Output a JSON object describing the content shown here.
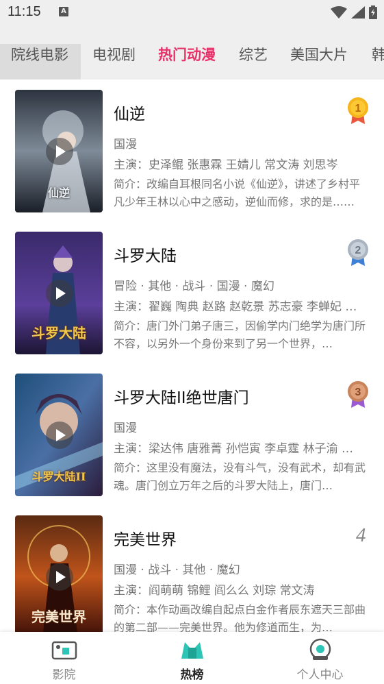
{
  "status_bar": {
    "time": "11:15",
    "notification_icon": "a-box-icon",
    "icons": [
      "wifi-icon",
      "signal-icon",
      "battery-charging-icon"
    ]
  },
  "tabs": [
    {
      "label": "院线电影",
      "active": false
    },
    {
      "label": "电视剧",
      "active": false
    },
    {
      "label": "热门动漫",
      "active": true
    },
    {
      "label": "综艺",
      "active": false
    },
    {
      "label": "美国大片",
      "active": false
    },
    {
      "label": "韩",
      "active": false
    }
  ],
  "accent_color": "#e8336a",
  "items": [
    {
      "title": "仙逆",
      "tags": "国漫",
      "cast": "主演：史泽鲲 张惠霖 王婧儿 常文涛 刘思岑",
      "intro": "简介：改编自耳根同名小说《仙逆》，讲述了乡村平凡少年王林以心中之感动，逆仙而修，求的是……",
      "rank": "1",
      "rank_style": "gold-medal-icon",
      "poster_caption": "仙逆"
    },
    {
      "title": "斗罗大陆",
      "tags": "冒险 · 其他 · 战斗 · 国漫 · 魔幻",
      "cast": "主演：翟巍 陶典 赵路 赵乾景 苏志豪 李蝉妃 …",
      "intro": "简介：唐门外门弟子唐三，因偷学内门绝学为唐门所不容，以另外一个身份来到了另一个世界，…",
      "rank": "2",
      "rank_style": "silver-medal-icon",
      "poster_caption": "斗罗大陆"
    },
    {
      "title": "斗罗大陆II绝世唐门",
      "tags": "国漫",
      "cast": "主演：梁达伟 唐雅菁 孙恺寅 李卓霆 林子渝 …",
      "intro": "简介：这里没有魔法，没有斗气，没有武术，却有武魂。唐门创立万年之后的斗罗大陆上，唐门…",
      "rank": "3",
      "rank_style": "bronze-medal-icon",
      "poster_caption": "斗罗大陆II"
    },
    {
      "title": "完美世界",
      "tags": "国漫 · 战斗 · 其他 · 魔幻",
      "cast": "主演：阎萌萌 锦鲤 阎么么 刘琮 常文涛",
      "intro": "简介：本作动画改编自起点白金作者辰东遮天三部曲的第二部——完美世界。他为修道而生，为…",
      "rank": "4",
      "rank_style": "plain-number",
      "poster_caption": "完美世界"
    }
  ],
  "bottom_nav": [
    {
      "label": "影院",
      "icon": "cinema-camera-icon",
      "active": false
    },
    {
      "label": "热榜",
      "icon": "crown-chart-icon",
      "active": true
    },
    {
      "label": "个人中心",
      "icon": "profile-disc-icon",
      "active": false
    }
  ]
}
